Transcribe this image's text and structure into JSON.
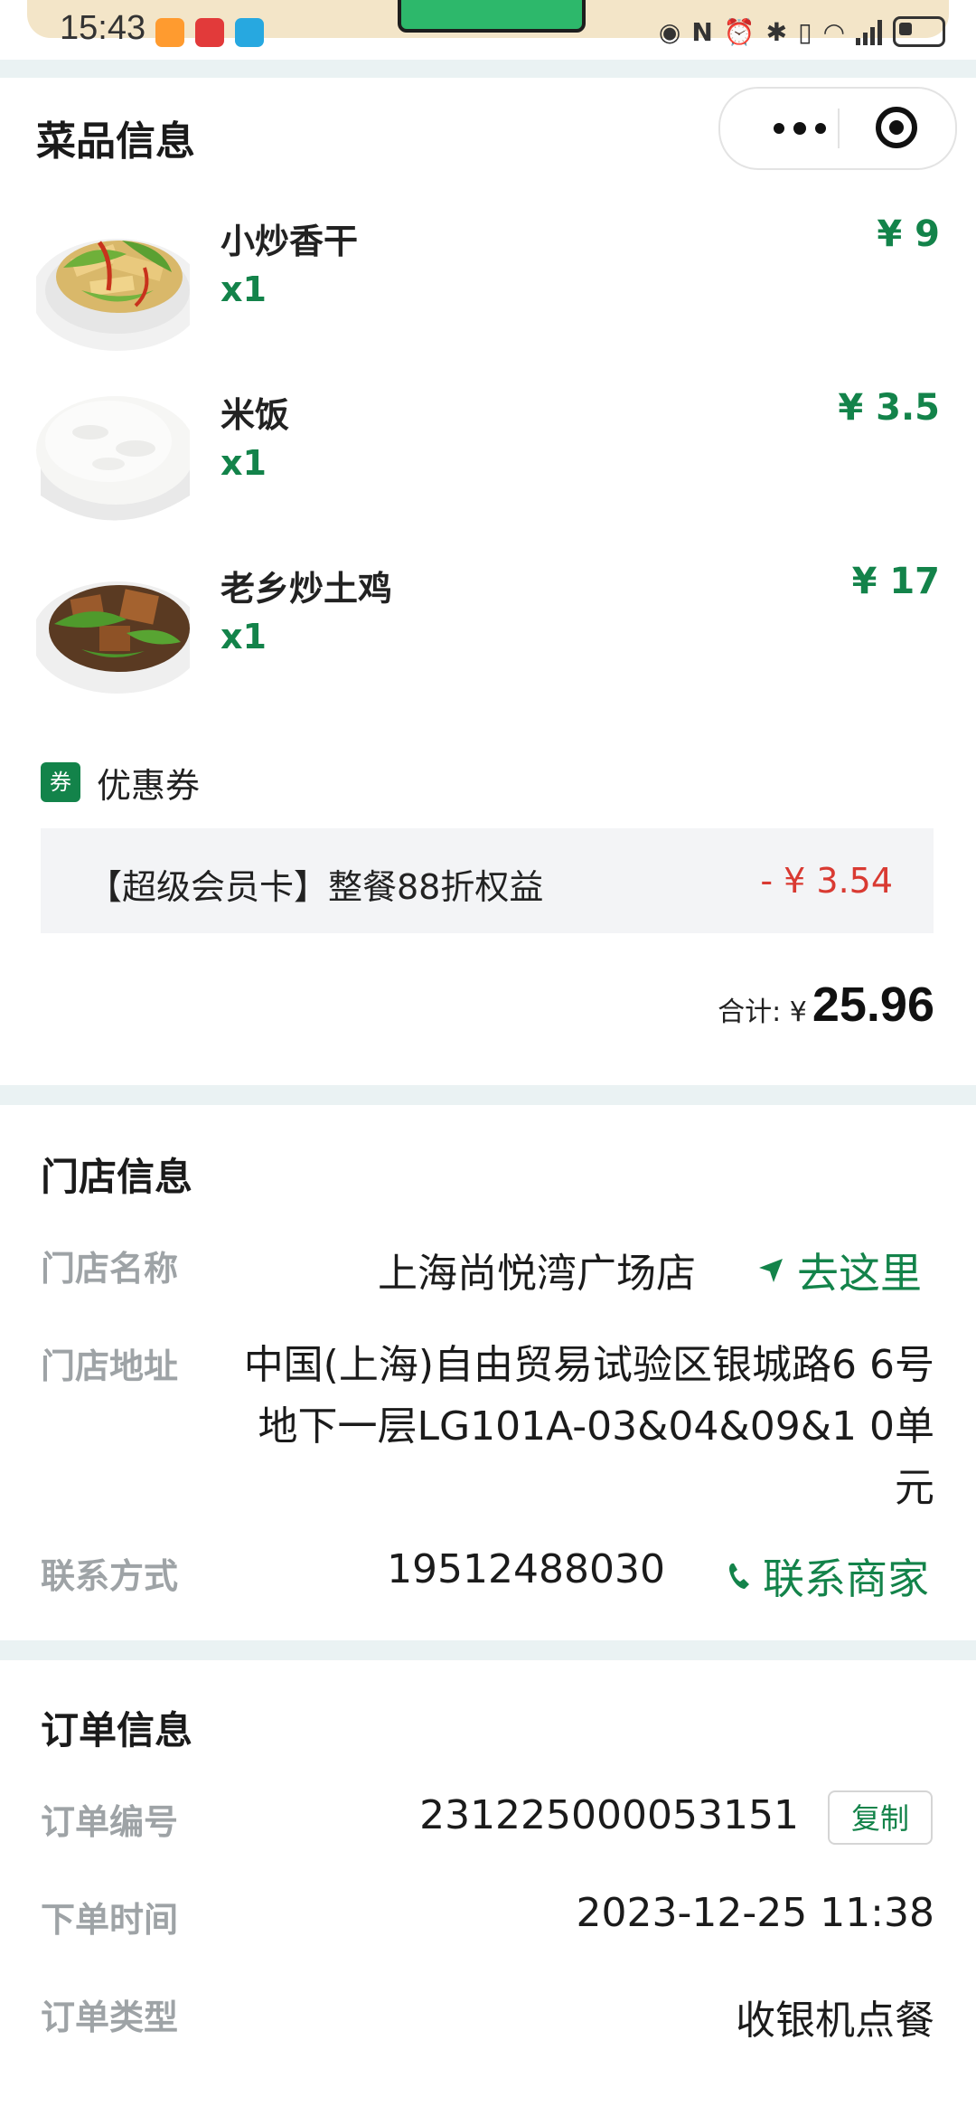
{
  "status_bar": {
    "time": "15:43"
  },
  "dishes_section": {
    "title": "菜品信息",
    "items": [
      {
        "name": "小炒香干",
        "qty": "x1",
        "price": "¥ 9"
      },
      {
        "name": "米饭",
        "qty": "x1",
        "price": "¥ 3.5"
      },
      {
        "name": "老乡炒土鸡",
        "qty": "x1",
        "price": "¥ 17"
      }
    ],
    "coupon": {
      "tag": "券",
      "title": "优惠券",
      "text": "【超级会员卡】整餐88折权益",
      "amount": "- ¥ 3.54"
    },
    "total_label": "合计: ¥",
    "total_value": "25.96"
  },
  "store_section": {
    "title": "门店信息",
    "name_label": "门店名称",
    "name_value": "上海尚悦湾广场店",
    "go_label": "去这里",
    "address_label": "门店地址",
    "address_value": "中国(上海)自由贸易试验区银城路6 6号地下一层LG101A-03&04&09&1 0单元",
    "contact_label": "联系方式",
    "contact_value": "19512488030",
    "call_label": "联系商家"
  },
  "order_section": {
    "title": "订单信息",
    "number_label": "订单编号",
    "number_value": "231225000053151",
    "copy_label": "复制",
    "time_label": "下单时间",
    "time_value": "2023-12-25 11:38",
    "type_label": "订单类型",
    "type_value": "收银机点餐"
  },
  "colors": {
    "accent": "#13834a",
    "discount": "#d93a32",
    "muted_label": "#9ea3a6",
    "coupon_bg": "#f3f4f6",
    "section_gap": "#eaf2f3"
  },
  "icons": [
    "menu-dots-icon",
    "target-icon",
    "location-arrow-icon",
    "phone-icon",
    "coupon-tag-icon"
  ]
}
